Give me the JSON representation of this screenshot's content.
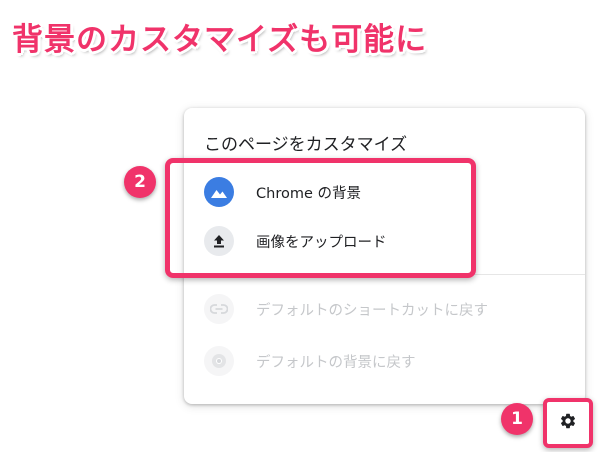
{
  "headline": "背景のカスタマイズも可能に",
  "panel": {
    "title": "このページをカスタマイズ",
    "items": [
      {
        "label": "Chrome の背景",
        "icon": "landscape-icon",
        "enabled": true
      },
      {
        "label": "画像をアップロード",
        "icon": "upload-icon",
        "enabled": true
      },
      {
        "label": "デフォルトのショートカットに戻す",
        "icon": "link-icon",
        "enabled": false
      },
      {
        "label": "デフォルトの背景に戻す",
        "icon": "chrome-icon",
        "enabled": false
      }
    ]
  },
  "annotations": {
    "badge_1": "1",
    "badge_2": "2"
  },
  "colors": {
    "accent": "#f0336a",
    "icon_blue": "#3b7de2",
    "disabled_text": "#c5c7ca"
  }
}
